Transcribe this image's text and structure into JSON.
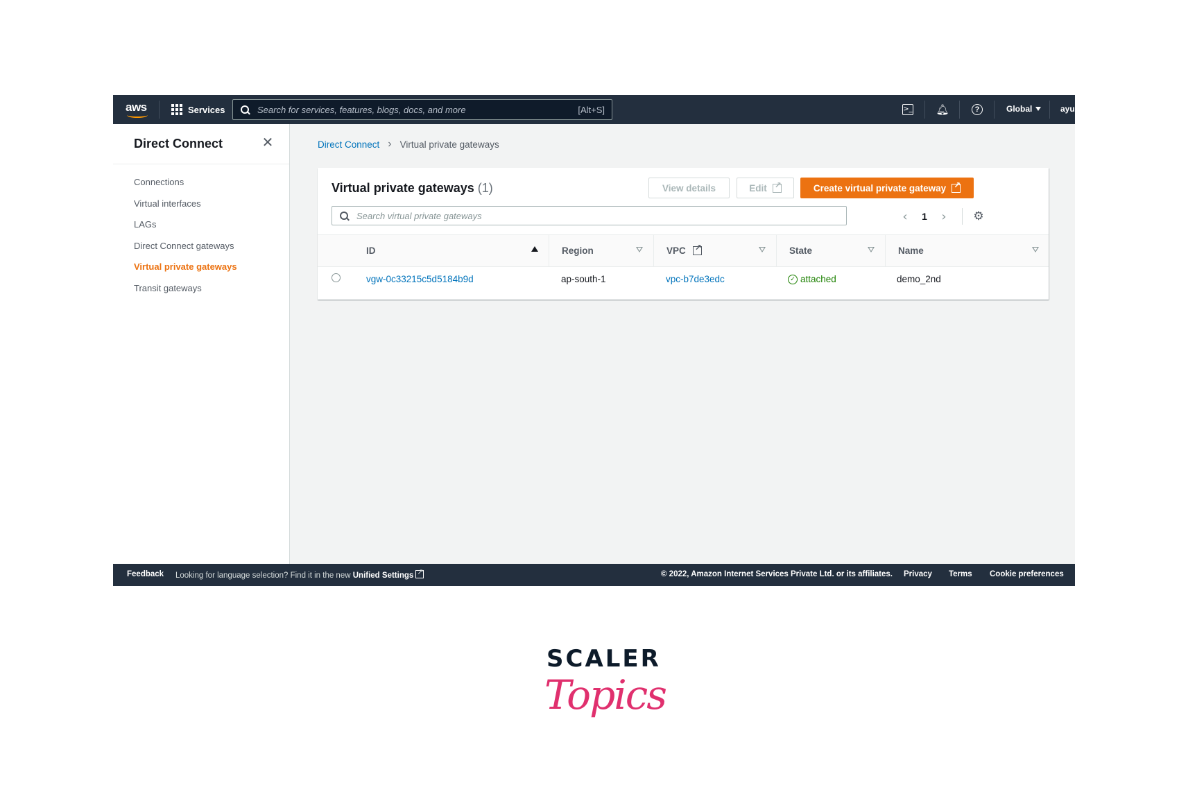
{
  "topnav": {
    "logo": "aws",
    "services_label": "Services",
    "search_placeholder": "Search for services, features, blogs, docs, and more",
    "search_shortcut": "[Alt+S]",
    "region": "Global",
    "user": "ayush",
    "icons": [
      "cloudshell-icon",
      "bell-icon",
      "help-icon"
    ]
  },
  "sidenav": {
    "title": "Direct Connect",
    "items": [
      {
        "label": "Connections"
      },
      {
        "label": "Virtual interfaces"
      },
      {
        "label": "LAGs"
      },
      {
        "label": "Direct Connect gateways"
      },
      {
        "label": "Virtual private gateways",
        "active": true
      },
      {
        "label": "Transit gateways"
      }
    ]
  },
  "breadcrumb": {
    "root": "Direct Connect",
    "current": "Virtual private gateways"
  },
  "panel": {
    "title": "Virtual private gateways",
    "count": "(1)",
    "view_details": "View details",
    "edit": "Edit",
    "create": "Create virtual private gateway",
    "search_placeholder": "Search virtual private gateways",
    "page": "1"
  },
  "table": {
    "columns": [
      "ID",
      "Region",
      "VPC",
      "State",
      "Name"
    ],
    "rows": [
      {
        "id": "vgw-0c33215c5d5184b9d",
        "region": "ap-south-1",
        "vpc": "vpc-b7de3edc",
        "state": "attached",
        "name": "demo_2nd"
      }
    ]
  },
  "footer": {
    "feedback": "Feedback",
    "language_text": "Looking for language selection? Find it in the new",
    "unified_settings": "Unified Settings",
    "copyright": "© 2022, Amazon Internet Services Private Ltd. or its affiliates.",
    "privacy": "Privacy",
    "terms": "Terms",
    "cookie": "Cookie preferences"
  },
  "brand": {
    "line1": "SCALER",
    "line2": "Topics"
  },
  "colors": {
    "nav_bg": "#232f3e",
    "accent": "#ec7211",
    "link": "#0073bb",
    "success": "#1d8102",
    "brand_pink": "#e0306e"
  }
}
